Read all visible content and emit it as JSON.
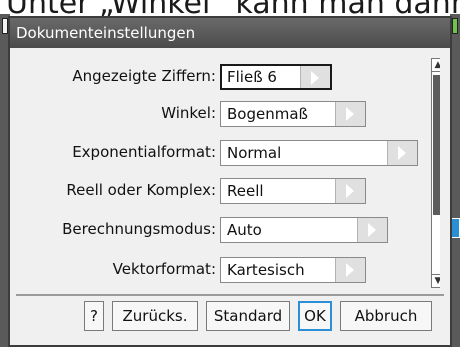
{
  "background": {
    "text": "Unter „Winkel“ kann man dann G"
  },
  "dialog": {
    "title": "Dokumenteinstellungen"
  },
  "settings": [
    {
      "label": "Angezeigte Ziffern:",
      "value": "Fließ 6"
    },
    {
      "label": "Winkel:",
      "value": "Bogenmaß"
    },
    {
      "label": "Exponentialformat:",
      "value": "Normal"
    },
    {
      "label": "Reell oder Komplex:",
      "value": "Reell"
    },
    {
      "label": "Berechnungsmodus:",
      "value": "Auto"
    },
    {
      "label": "Vektorformat:",
      "value": "Kartesisch"
    }
  ],
  "scrollbar": {
    "up_glyph": "▲",
    "down_glyph": "▼"
  },
  "buttons": {
    "help": "?",
    "reset": "Zurücks.",
    "standard": "Standard",
    "ok": "OK",
    "cancel": "Abbruch"
  },
  "colors": {
    "title_bar": "#4b4b4b",
    "dialog_bg": "#f0f0f0",
    "focus_border": "#2b8fd6",
    "right_strip_icon": "#6fc34c"
  }
}
